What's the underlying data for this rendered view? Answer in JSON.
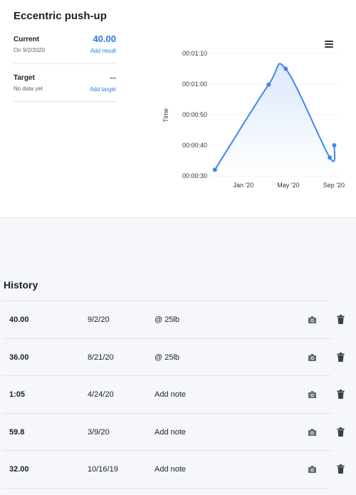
{
  "exercise": {
    "title": "Eccentric push-up"
  },
  "current": {
    "label": "Current",
    "date": "On 9/2/2020",
    "value": "40.00",
    "action": "Add result"
  },
  "target": {
    "label": "Target",
    "status": "No data yet",
    "value": "--",
    "action": "Add target"
  },
  "chart_data": {
    "type": "line",
    "ylabel": "Time",
    "y_ticks": [
      "00:00:30",
      "00:00:40",
      "00:00:50",
      "00:01:00",
      "00:01:10"
    ],
    "x_ticks": [
      "Jan '20",
      "May '20",
      "Sep '20"
    ],
    "ylim": [
      30,
      70
    ],
    "xlim": [
      "2019-10-01",
      "2020-09-05"
    ],
    "series": [
      {
        "points": [
          {
            "x": "2019-10-16",
            "y": 32
          },
          {
            "x": "2020-03-09",
            "y": 59.8
          },
          {
            "x": "2020-04-24",
            "y": 65
          },
          {
            "x": "2020-08-21",
            "y": 36
          },
          {
            "x": "2020-09-02",
            "y": 40
          }
        ]
      }
    ],
    "colors": {
      "line": "#3f86ef",
      "fill_top": "#dce8fb",
      "fill_bottom": "#ffffff"
    }
  },
  "history": {
    "title": "History",
    "rows": [
      {
        "value": "40.00",
        "date": "9/2/20",
        "note": "@ 25lb"
      },
      {
        "value": "36.00",
        "date": "8/21/20",
        "note": "@ 25lb"
      },
      {
        "value": "1:05",
        "date": "4/24/20",
        "note": "Add note"
      },
      {
        "value": "59.8",
        "date": "3/9/20",
        "note": "Add note"
      },
      {
        "value": "32.00",
        "date": "10/16/19",
        "note": "Add note"
      }
    ]
  },
  "icons": {
    "menu": "hamburger-menu-icon",
    "camera": "camera-icon",
    "trash": "trash-icon"
  }
}
